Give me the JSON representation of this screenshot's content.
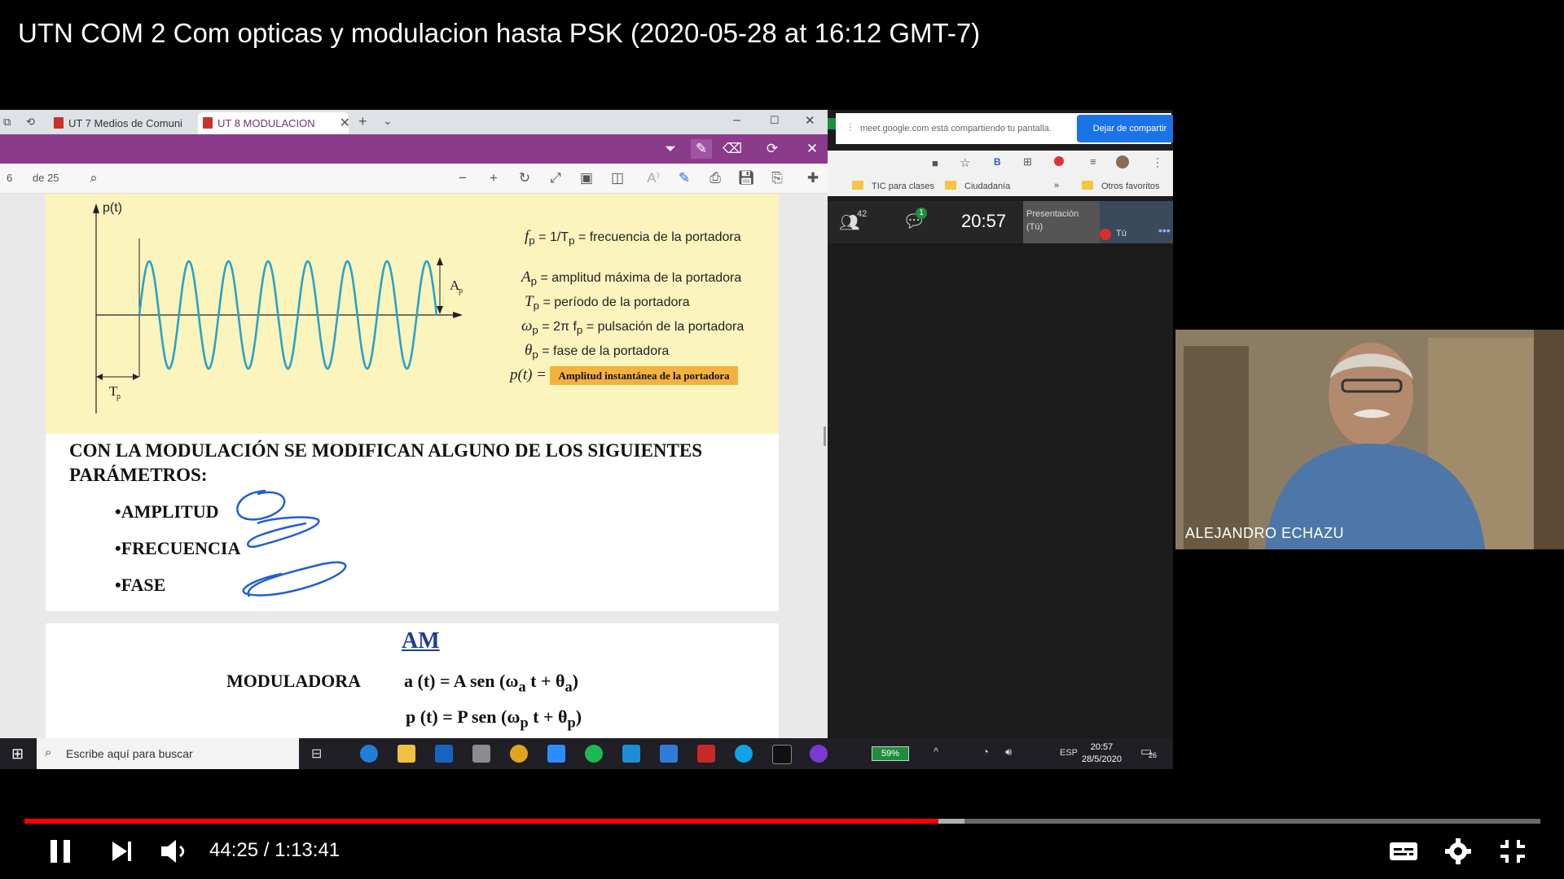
{
  "video": {
    "title": "UTN COM 2 Com opticas y modulacion hasta PSK (2020-05-28 at 16:12 GMT-7)"
  },
  "browser": {
    "tabs": [
      {
        "label": "UT 7 Medios de Comuni",
        "active": false
      },
      {
        "label": "UT 8 MODULACION",
        "active": true
      }
    ]
  },
  "pdf_toolbar": {
    "page_number": "6",
    "page_total": "de 25"
  },
  "slide": {
    "chart_labels": {
      "y_axis": "p(t)",
      "amplitude": "A",
      "amplitude_sub": "p",
      "period": "T",
      "period_sub": "p"
    },
    "legend": [
      {
        "symbol": "f",
        "sub": "p",
        "eq": "= 1/T",
        "eq_sub": "p",
        "text": "= frecuencia de la portadora"
      },
      {
        "symbol": "A",
        "sub": "p",
        "text": "= amplitud máxima de la portadora"
      },
      {
        "symbol": "T",
        "sub": "p",
        "text": "= período de la portadora"
      },
      {
        "symbol": "ω",
        "sub": "p",
        "eq": "= 2π f",
        "eq_sub": "p",
        "text": "= pulsación de la portadora"
      },
      {
        "symbol": "θ",
        "sub": "p",
        "text": "= fase de la portadora"
      }
    ],
    "pt_label": "p(t) =",
    "pt_highlight": "Amplitud instantánea de la portadora",
    "heading_line1": "CON LA MODULACIÓN SE MODIFICAN ALGUNO DE LOS SIGUIENTES",
    "heading_line2": "PARÁMETROS:",
    "parameters": [
      "•AMPLITUD",
      "•FRECUENCIA",
      "•FASE"
    ],
    "am_title": "AM",
    "moduladora_label": "MODULADORA",
    "mod_eq": "a (t) = A sen (ω",
    "mod_eq_sub": "a",
    "mod_eq_tail": " t + θ",
    "mod_eq_sub2": "a",
    "carrier_eq": "p (t) = P sen (ω",
    "carrier_eq_sub": "p",
    "carrier_eq_tail": " t + θ",
    "carrier_eq_sub2": "p"
  },
  "meet": {
    "share_text": "meet.google.com está compartiendo tu pantalla.",
    "stop_share": "Dejar de compartir",
    "bookmarks": [
      "TIC para clases",
      "Ciudadanía",
      "Otros favoritos"
    ],
    "participants": "42",
    "chat_badge": "1",
    "time": "20:57",
    "presentation_label": "Presentación (Tú)",
    "you_label": "Tú"
  },
  "taskbar": {
    "search_placeholder": "Escribe aquí para buscar",
    "battery": "59%",
    "language": "ESP",
    "clock_time": "20:57",
    "clock_date": "28/5/2020",
    "notifications": "26"
  },
  "webcam": {
    "name": "ALEJANDRO ECHAZU"
  },
  "player": {
    "current_time": "44:25",
    "duration": "1:13:41",
    "time_display": "44:25 / 1:13:41",
    "played_fraction": 0.603,
    "buffered_fraction": 0.62
  },
  "colors": {
    "accent_purple": "#8a3b8c",
    "slide_yellow": "#fbf4bd",
    "progress_red": "#ff0000",
    "meet_blue": "#1a73e8",
    "highlight_orange": "#f5b13d",
    "ink_blue": "#1f5fd1"
  }
}
